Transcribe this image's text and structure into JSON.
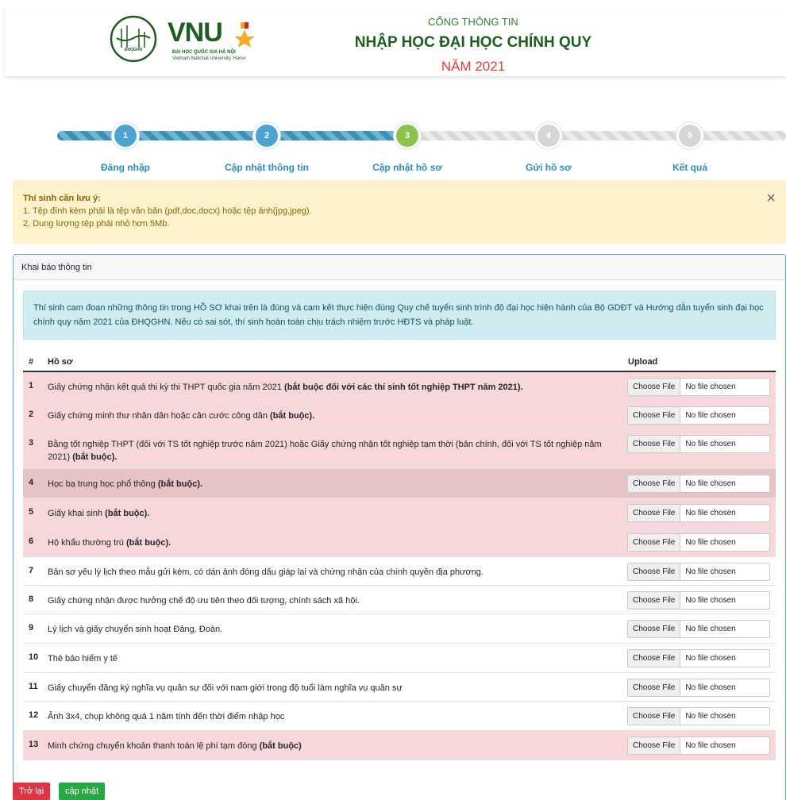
{
  "header": {
    "logo_badge": "ĐHQGHN",
    "logo_text": "VNU",
    "logo_sub1": "ĐẠI HỌC QUỐC GIA HÀ NỘI",
    "logo_sub2": "Vietnam National University, Hanoi",
    "line1": "CỔNG THÔNG TIN",
    "line2": "NHẬP HỌC ĐẠI HỌC CHÍNH QUY",
    "line3": "NĂM 2021"
  },
  "stepper": {
    "steps": [
      {
        "num": "1",
        "label": "Đăng nhập",
        "status": "done"
      },
      {
        "num": "2",
        "label": "Cập nhật thông tin",
        "status": "done"
      },
      {
        "num": "3",
        "label": "Cập nhật hồ sơ",
        "status": "current"
      },
      {
        "num": "4",
        "label": "Gửi hồ sơ",
        "status": "todo"
      },
      {
        "num": "5",
        "label": "Kết quả",
        "status": "todo"
      }
    ],
    "colors": {
      "done": "#4aa3d1",
      "current": "#8bc34a",
      "todo": "#d6d6d6",
      "label_done": "#2b8cc4",
      "label_current": "#2b8cc4",
      "label_todo": "#2b8cc4"
    }
  },
  "alert": {
    "title": "Thí sinh cần lưu ý:",
    "line1": "1. Tệp đính kèm phải là tệp văn bản (pdf,doc,docx) hoặc tệp ảnh(jpg,jpeg).",
    "line2": "2. Dung lượng tệp phải nhỏ hơn 5Mb.",
    "close": "×"
  },
  "card": {
    "header": "Khai báo thông tin",
    "info": "Thí sinh cam đoan những thông tin trong HỒ SƠ khai trên là đúng và cam kết thực hiện đúng Quy chế tuyển sinh trình độ đại học hiện hành của Bộ GDĐT và Hướng dẫn tuyển sinh đại học chính quy năm 2021 của ĐHQGHN. Nếu có sai sót, thí sinh hoàn toàn chịu trách nhiệm trước HĐTS và pháp luật."
  },
  "table": {
    "col_num": "#",
    "col_doc": "Hồ sơ",
    "col_upload": "Upload",
    "choose_label": "Choose File",
    "no_file_label": "No file chosen",
    "rows": [
      {
        "num": "1",
        "text": "Giấy chứng nhận kết quả thi kỳ thi THPT quốc gia năm 2021 ",
        "bold": "(bắt buộc đối với các thí sinh tốt nghiệp THPT năm 2021).",
        "style": "req"
      },
      {
        "num": "2",
        "text": "Giấy chứng minh thư nhân dân hoặc căn cước công dân ",
        "bold": "(bắt buộc).",
        "style": "req"
      },
      {
        "num": "3",
        "text": "Bằng tốt nghiệp THPT (đối với TS tốt nghiệp trước năm 2021) hoặc Giấy chứng nhận tốt nghiệp tạm thời (bản chính, đối với TS tốt nghiệp năm 2021) ",
        "bold": "(bắt buộc).",
        "style": "req"
      },
      {
        "num": "4",
        "text": "Học bạ trung học phổ thông ",
        "bold": "(bắt buộc).",
        "style": "hl"
      },
      {
        "num": "5",
        "text": "Giấy khai sinh ",
        "bold": "(bắt buộc).",
        "style": "req"
      },
      {
        "num": "6",
        "text": "Hộ khẩu thường trú ",
        "bold": "(bắt buộc).",
        "style": "req"
      },
      {
        "num": "7",
        "text": "Bản sơ yếu lý lịch theo mẫu gửi kèm, có dán ảnh đóng dấu giáp lai và chứng nhận của chính quyền địa phương.",
        "bold": "",
        "style": "plain"
      },
      {
        "num": "8",
        "text": "Giấy chứng nhận được hưởng chế độ ưu tiên theo đối tượng, chính sách xã hội.",
        "bold": "",
        "style": "plain"
      },
      {
        "num": "9",
        "text": "Lý lịch và giấy chuyển sinh hoạt Đảng, Đoàn.",
        "bold": "",
        "style": "plain"
      },
      {
        "num": "10",
        "text": "Thẻ bảo hiểm y tế",
        "bold": "",
        "style": "plain"
      },
      {
        "num": "11",
        "text": "Giấy chuyển đăng ký nghĩa vụ quân sự đối với nam giới trong độ tuổi làm nghĩa vụ quân sự",
        "bold": "",
        "style": "plain"
      },
      {
        "num": "12",
        "text": "Ảnh 3x4, chụp không quá 1 năm tính đến thời điểm nhập học",
        "bold": "",
        "style": "plain"
      },
      {
        "num": "13",
        "text": "Minh chứng chuyển khoản thanh toán lệ phí tạm đóng ",
        "bold": "(bắt buộc)",
        "style": "req"
      }
    ]
  },
  "buttons": {
    "back": "Trở lại",
    "update": "cập nhật"
  }
}
